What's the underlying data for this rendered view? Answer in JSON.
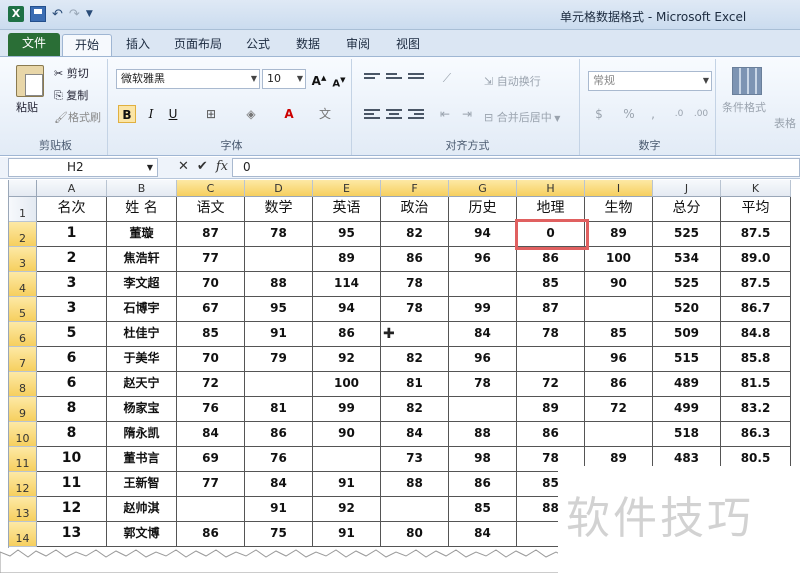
{
  "window": {
    "title": "单元格数据格式 - Microsoft Excel",
    "app_icon": "X"
  },
  "tabs": [
    "文件",
    "开始",
    "插入",
    "页面布局",
    "公式",
    "数据",
    "审阅",
    "视图"
  ],
  "ribbon": {
    "clipboard": {
      "paste": "粘贴",
      "cut": "剪切",
      "copy": "复制",
      "format_painter": "格式刷",
      "group": "剪贴板"
    },
    "font": {
      "family": "微软雅黑",
      "size": "10",
      "bold": "B",
      "italic": "I",
      "underline": "U",
      "group": "字体"
    },
    "alignment": {
      "wrap": "自动换行",
      "merge": "合并后居中",
      "group": "对齐方式"
    },
    "number": {
      "format": "常规",
      "group": "数字"
    },
    "styles": {
      "conditional": "条件格式",
      "table": "表格"
    }
  },
  "formula_bar": {
    "name_box": "H2",
    "fx": "fx",
    "value": "0"
  },
  "sheet": {
    "columns": [
      "A",
      "B",
      "C",
      "D",
      "E",
      "F",
      "G",
      "H",
      "I",
      "J",
      "K"
    ],
    "highlight_cols": [
      "C",
      "D",
      "E",
      "F",
      "G",
      "H",
      "I"
    ],
    "rows": [
      "1",
      "2",
      "3",
      "4",
      "5",
      "6",
      "7",
      "8",
      "9",
      "10",
      "11",
      "12",
      "13",
      "14"
    ],
    "header": [
      "名次",
      "姓 名",
      "语文",
      "数学",
      "英语",
      "政治",
      "历史",
      "地理",
      "生物",
      "总分",
      "平均"
    ],
    "data": [
      [
        "1",
        "董璇",
        "87",
        "78",
        "95",
        "82",
        "94",
        "0",
        "89",
        "525",
        "87.5"
      ],
      [
        "2",
        "焦浩轩",
        "77",
        "",
        "89",
        "86",
        "96",
        "86",
        "100",
        "534",
        "89.0"
      ],
      [
        "3",
        "李文超",
        "70",
        "88",
        "114",
        "78",
        "",
        "85",
        "90",
        "525",
        "87.5"
      ],
      [
        "3",
        "石博宇",
        "67",
        "95",
        "94",
        "78",
        "99",
        "87",
        "",
        "520",
        "86.7"
      ],
      [
        "5",
        "杜佳宁",
        "85",
        "91",
        "86",
        "",
        "84",
        "78",
        "85",
        "509",
        "84.8"
      ],
      [
        "6",
        "于美华",
        "70",
        "79",
        "92",
        "82",
        "96",
        "",
        "96",
        "515",
        "85.8"
      ],
      [
        "6",
        "赵天宁",
        "72",
        "",
        "100",
        "81",
        "78",
        "72",
        "86",
        "489",
        "81.5"
      ],
      [
        "8",
        "杨家宝",
        "76",
        "81",
        "99",
        "82",
        "",
        "89",
        "72",
        "499",
        "83.2"
      ],
      [
        "8",
        "隋永凯",
        "84",
        "86",
        "90",
        "84",
        "88",
        "86",
        "",
        "518",
        "86.3"
      ],
      [
        "10",
        "董书言",
        "69",
        "76",
        "",
        "73",
        "98",
        "78",
        "89",
        "483",
        "80.5"
      ],
      [
        "11",
        "王新智",
        "77",
        "84",
        "91",
        "88",
        "86",
        "85",
        "",
        "",
        ""
      ],
      [
        "12",
        "赵帅淇",
        "",
        "91",
        "92",
        "",
        "85",
        "88",
        "",
        "",
        ""
      ],
      [
        "13",
        "郭文博",
        "86",
        "75",
        "91",
        "80",
        "84",
        "",
        "",
        "",
        ""
      ]
    ],
    "blue_cells": [
      [
        1,
        3
      ],
      [
        2,
        6
      ],
      [
        3,
        8
      ],
      [
        4,
        5
      ],
      [
        5,
        7
      ],
      [
        6,
        3
      ],
      [
        7,
        6
      ],
      [
        8,
        8
      ],
      [
        9,
        4
      ],
      [
        11,
        2
      ],
      [
        11,
        5
      ],
      [
        12,
        7
      ]
    ]
  },
  "watermark": "软件技巧"
}
